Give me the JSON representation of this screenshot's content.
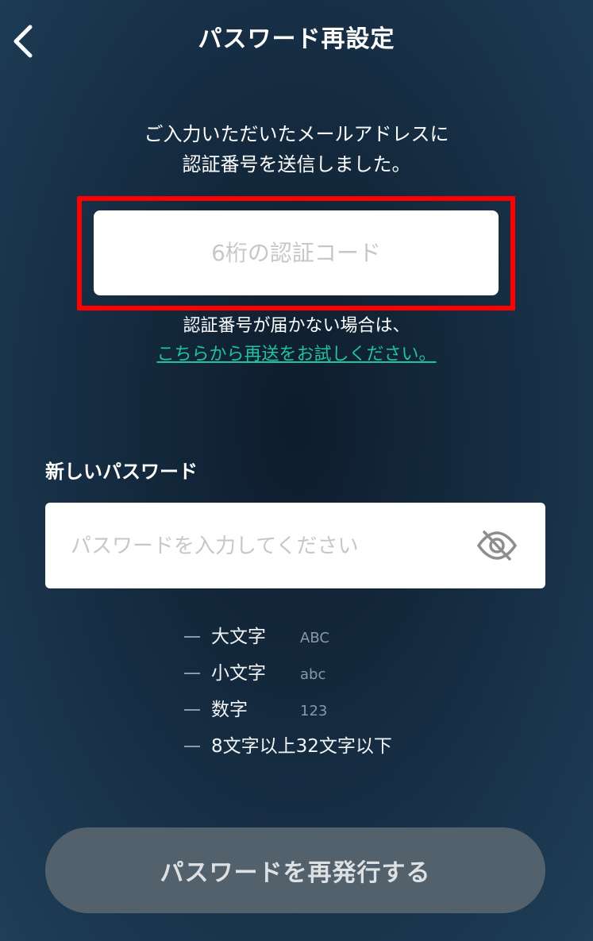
{
  "header": {
    "title": "パスワード再設定",
    "back_icon": "chevron-left-icon"
  },
  "intro": {
    "line1": "ご入力いただいたメールアドレスに",
    "line2": "認証番号を送信しました。"
  },
  "code_input": {
    "placeholder": "6桁の認証コード",
    "value": ""
  },
  "resend": {
    "note": "認証番号が届かない場合は、",
    "link": "こちらから再送をお試しください。",
    "link_color": "#20c3a0"
  },
  "password": {
    "label": "新しいパスワード",
    "placeholder": "パスワードを入力してください",
    "value": "",
    "toggle_icon": "eye-slash-icon"
  },
  "rules": [
    {
      "label": "大文字",
      "sample": "ABC"
    },
    {
      "label": "小文字",
      "sample": "abc"
    },
    {
      "label": "数字",
      "sample": "123"
    },
    {
      "label": "8文字以上32文字以下",
      "sample": ""
    }
  ],
  "submit": {
    "label": "パスワードを再発行する"
  },
  "colors": {
    "highlight": "#ff0000",
    "button_bg": "#53616d"
  }
}
